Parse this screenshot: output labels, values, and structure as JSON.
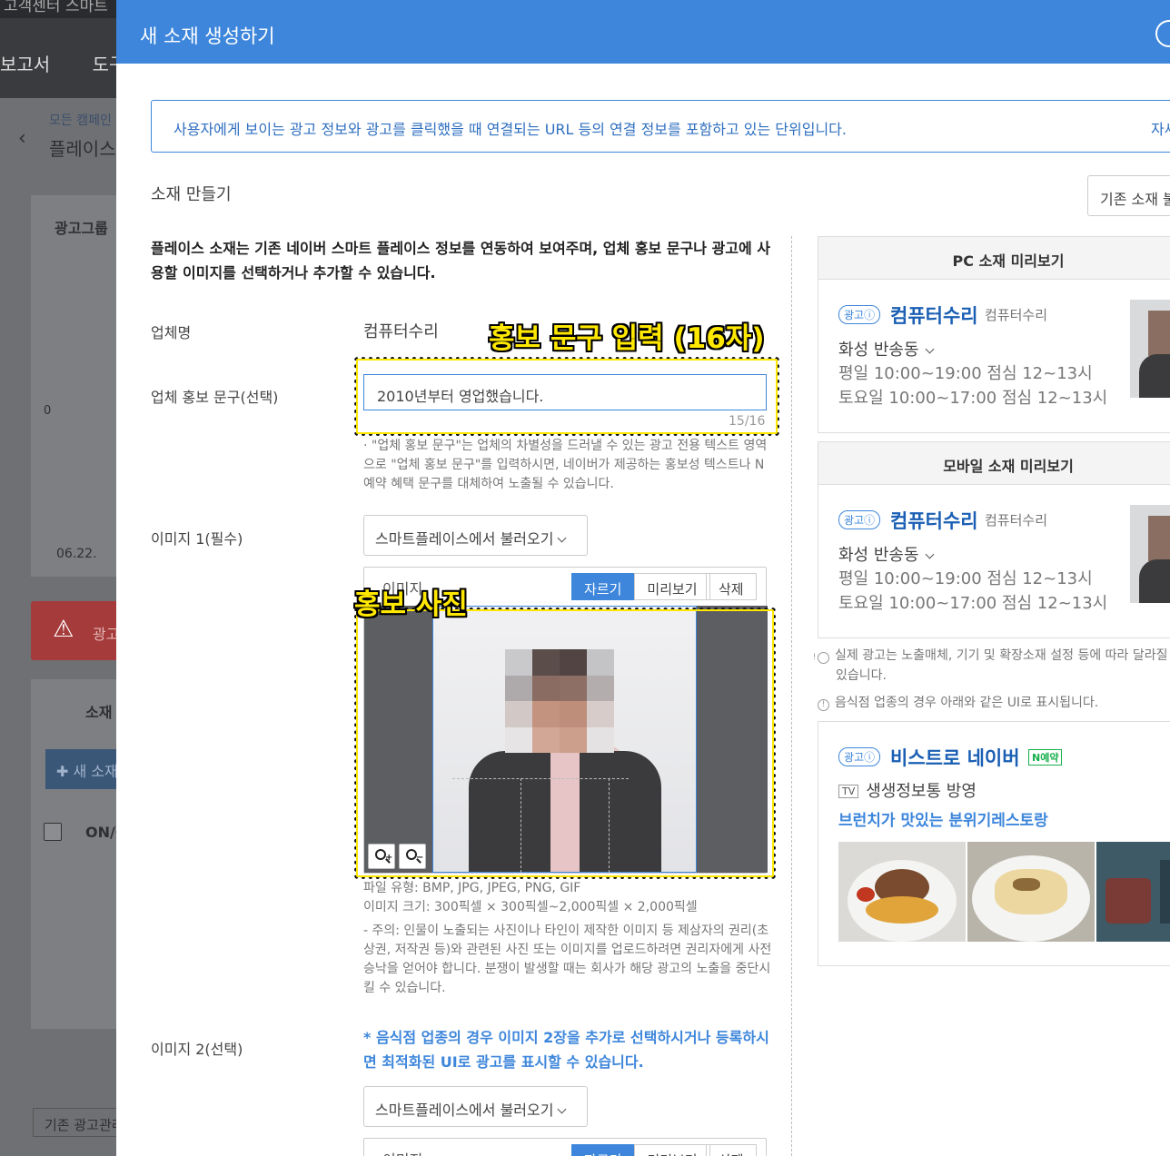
{
  "background": {
    "top_strip": "고객센터  스마트",
    "menu": [
      "보고서",
      "도구"
    ],
    "breadcrumb": "모든 캠페인",
    "campaign": "플레이스",
    "ad_group_tab": "광고그룹",
    "chart_zero": "0",
    "chart_date": "06.22.",
    "warning": "광고",
    "creative_tab": "소재",
    "new_creative": "새 소재",
    "table_on": "ON/O",
    "old_manager": "기존 광고관리"
  },
  "modal": {
    "title": "새 소재 생성하기",
    "info": "사용자에게 보이는 광고 정보와 광고를 클릭했을 때 연결되는 URL 등의 연결 정보를 포함하고 있는 단위입니다.",
    "info_link": "자세히",
    "section_title": "소재 만들기",
    "existing_button": "기존 소재 불러오기",
    "description": "플레이스 소재는 기존 네이버 스마트 플레이스 정보를 연동하여 보여주며, 업체 홍보 문구나 광고에 사용할 이미지를 선택하거나 추가할 수 있습니다.",
    "business_name_label": "업체명",
    "business_name_value": "컴퓨터수리",
    "promo_label": "업체 홍보 문구(선택)",
    "promo_value": "2010년부터 영업했습니다.",
    "promo_counter": "15/16",
    "promo_help": "· \"업체 홍보 문구\"는 업체의 차별성을 드러낼 수 있는 광고 전용 텍스트 영역으로 \"업체 홍보 문구\"를 입력하시면, 네이버가 제공하는 홍보성 텍스트나 N예약 혜택 문구를 대체하여 노출될 수 있습니다.",
    "image1_label": "이미지 1(필수)",
    "image_select": "스마트플레이스에서 불러오기",
    "image_panel_label": "이미지",
    "tab_crop": "자르기",
    "tab_preview": "미리보기",
    "tab_delete": "삭제",
    "file_type": "파일 유형: BMP, JPG, JPEG, PNG, GIF",
    "image_size": "이미지 크기: 300픽셀 × 300픽셀~2,000픽셀 × 2,000픽셀",
    "caution": "- 주의: 인물이 노출되는 사진이나 타인이 제작한 이미지 등 제삼자의 권리(초상권, 저작권 등)와 관련된 사진 또는 이미지를 업로드하려면 권리자에게 사전 승낙을 얻어야 합니다. 분쟁이 발생할 때는 회사가 해당 광고의 노출을 중단시킬 수 있습니다.",
    "image2_label": "이미지 2(선택)",
    "image2_note": "* 음식점 업종의 경우 이미지 2장을 추가로 선택하시거나 등록하시면 최적화된 UI로 광고를 표시할 수 있습니다."
  },
  "annotations": {
    "promo": "홍보 문구 입력 (16자)",
    "photo": "홍보 사진"
  },
  "preview": {
    "pc_title": "PC 소재 미리보기",
    "mobile_title": "모바일 소재 미리보기",
    "ad_badge": "광고ⓘ",
    "business": "컴퓨터수리",
    "category": "컴퓨터수리",
    "location": "화성 반송동",
    "hours": "평일 10:00~19:00 점심 12~13시 토요일 10:00~17:00 점심 12~13시",
    "note1": "실제 광고는 노출매체, 기기 및 확장소재 설정 등에 따라 달라질 수 있습니다.",
    "note2": "음식점 업종의 경우 아래와 같은 UI로 표시됩니다.",
    "bistro_name": "비스트로 네이버",
    "bistro_badge": "N예약",
    "tv_badge": "TV",
    "tv_text": "생생정보통 방영",
    "bistro_slogan": "브런치가 맛있는 분위기레스토랑"
  },
  "colors": {
    "accent": "#3d86db",
    "annotation": "#ffe800"
  }
}
